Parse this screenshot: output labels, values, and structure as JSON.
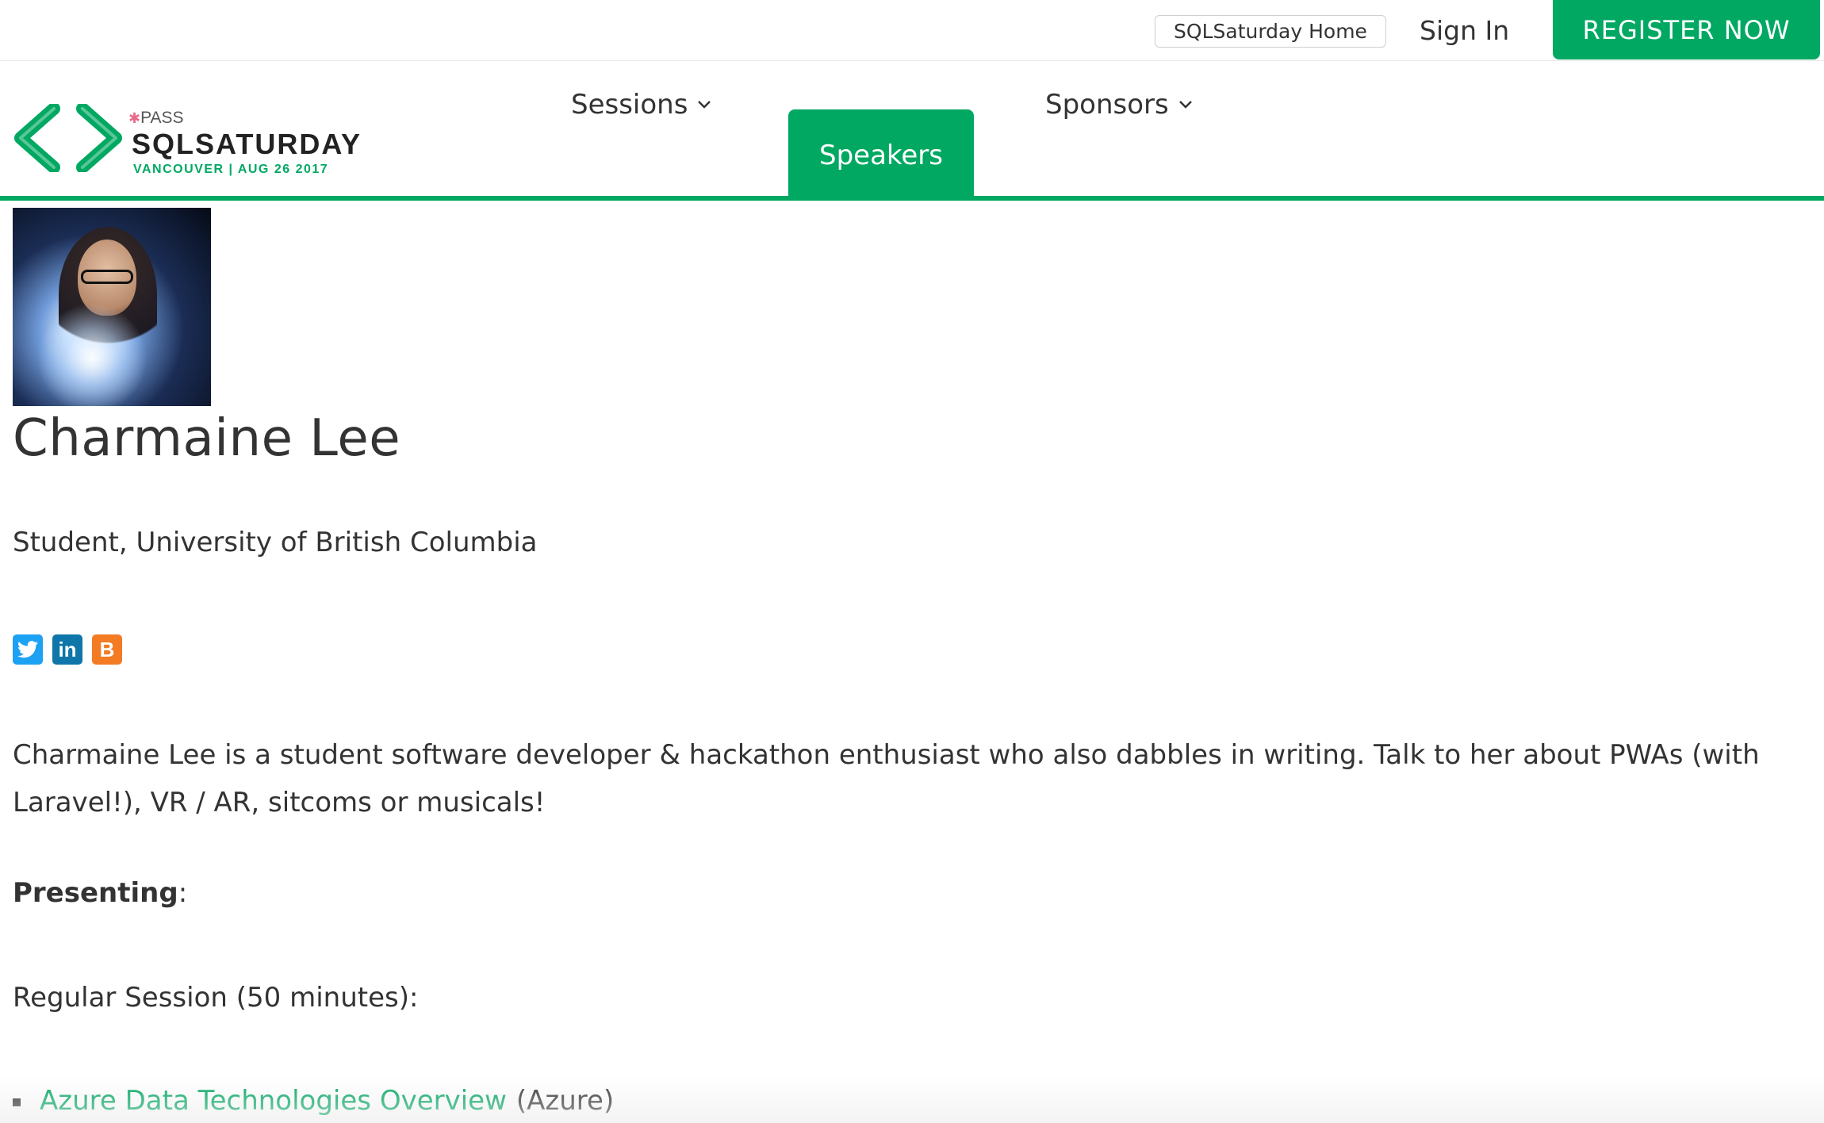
{
  "topbar": {
    "home_label": "SQLSaturday Home",
    "signin_label": "Sign In",
    "register_label": "REGISTER NOW"
  },
  "logo": {
    "pass_text": "PASS",
    "brand_text": "SQLSATURDAY",
    "sub_text": "VANCOUVER | AUG 26 2017"
  },
  "nav": {
    "items": [
      {
        "label": "Sessions",
        "has_dropdown": true,
        "active": false
      },
      {
        "label": "Speakers",
        "has_dropdown": false,
        "active": true
      },
      {
        "label": "Sponsors",
        "has_dropdown": true,
        "active": false
      }
    ]
  },
  "speaker": {
    "name": "Charmaine Lee",
    "title": "Student, University of British Columbia",
    "social": [
      {
        "icon": "twitter-icon"
      },
      {
        "icon": "linkedin-icon"
      },
      {
        "icon": "blogger-icon"
      }
    ],
    "bio": "Charmaine Lee is a student software developer & hackathon enthusiast who also dabbles in writing. Talk to her about PWAs (with Laravel!), VR / AR, sitcoms or musicals!",
    "presenting_label": "Presenting",
    "presenting_suffix": ":",
    "session_type": "Regular Session (50 minutes):",
    "sessions": [
      {
        "title": "Azure Data Technologies Overview",
        "track": "(Azure)"
      }
    ]
  },
  "colors": {
    "accent": "#00a862",
    "text": "#333333",
    "twitter": "#1da1f2",
    "linkedin": "#0e76a8",
    "blogger": "#f37b24"
  }
}
